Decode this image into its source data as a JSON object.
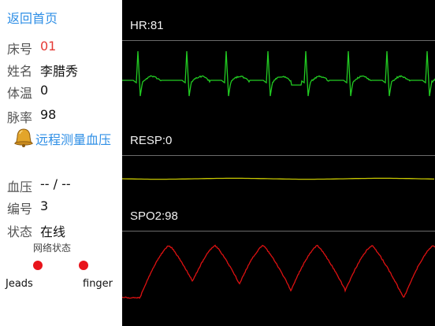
{
  "nav": {
    "back_label": "返回首页"
  },
  "patient": {
    "bed_label": "床号",
    "bed_value": "01",
    "name_label": "姓名",
    "name_value": "李腊秀",
    "temp_label": "体温",
    "temp_value": "0",
    "pulse_label": "脉率",
    "pulse_value": "98"
  },
  "actions": {
    "remote_bp_label": "远程测量血压",
    "remote_bp_icon": "bell-icon"
  },
  "device": {
    "bp_label": "血压",
    "bp_value": "-- / --",
    "id_label": "编号",
    "id_value": "3",
    "status_label": "状态",
    "status_value": "在线",
    "network_label": "网络状态",
    "leads_label": "Jeads",
    "finger_label": "finger",
    "leads_color": "#e8141b",
    "finger_color": "#e8141b"
  },
  "channels": {
    "hr_label": "HR:81",
    "resp_label": "RESP:0",
    "spo2_label": "SPO2:98"
  },
  "colors": {
    "accent": "#2f8fe6",
    "bed_value": "#e53935",
    "ecg_trace": "#22cc22",
    "resp_trace": "#c8c800",
    "spo2_trace": "#dd1111",
    "monitor_bg": "#000000"
  }
}
